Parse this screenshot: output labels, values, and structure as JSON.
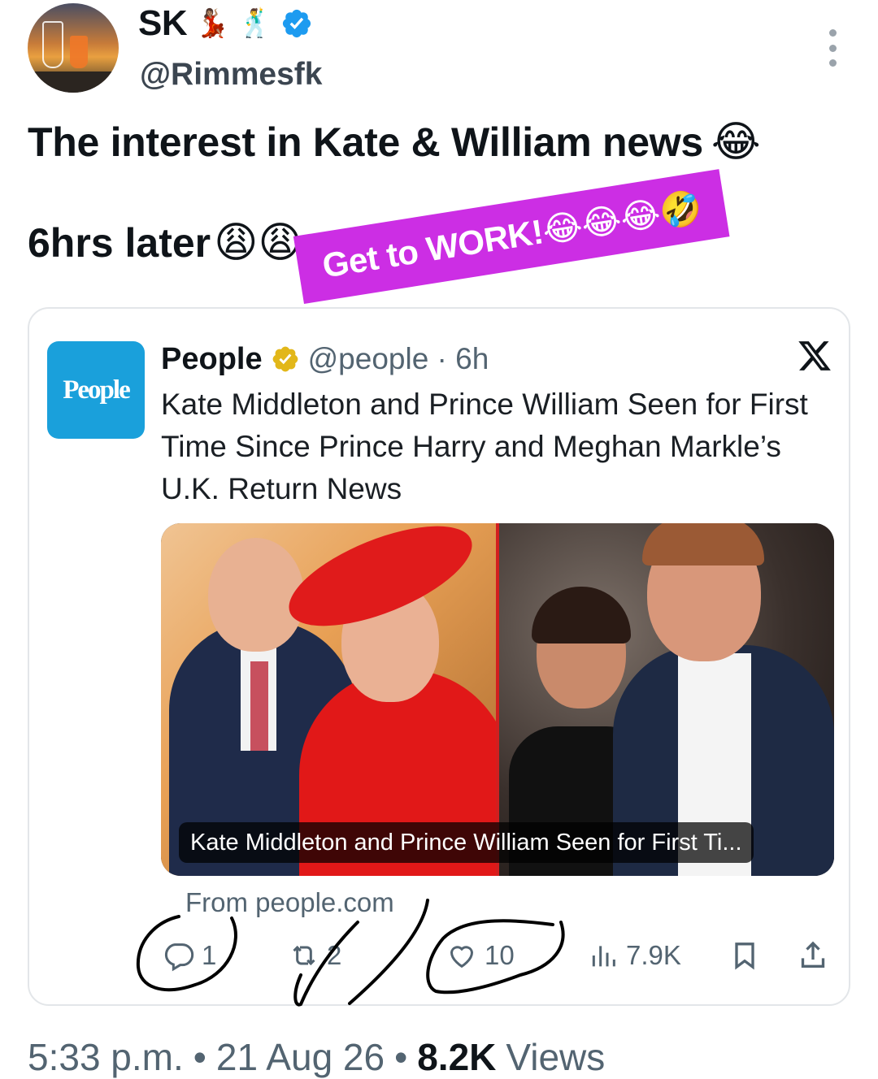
{
  "header": {
    "display_name": "SK",
    "name_emoji_1": "💃🏽",
    "name_emoji_2": "🕺",
    "handle": "@Rimmesfk"
  },
  "tweet": {
    "line1": "The interest in Kate & William news",
    "line1_emoji": "😂",
    "line2": "6hrs later",
    "line2_emoji": "😩😩"
  },
  "sticker": {
    "text": "Get to WORK!😂😂😂🤣"
  },
  "quoted": {
    "logo_text": "People",
    "source_name": "People",
    "source_handle": "@people · 6h",
    "headline": "Kate Middleton and Prince William Seen for First Time Since Prince Harry and Meghan Markle’s U.K. Return News",
    "image_caption": "Kate Middleton and Prince William Seen for First Ti...",
    "from_text": "From people.com"
  },
  "actions": {
    "reply_count": "1",
    "retweet_count": "2",
    "like_count": "10",
    "views_count": "7.9K"
  },
  "meta": {
    "time": "5:33 p.m.",
    "date": "21 Aug 26",
    "views_number": "8.2K",
    "views_label": "Views"
  },
  "colors": {
    "verified_blue": "#1d9bf0",
    "sticker_purple": "#cc2ee4",
    "people_blue": "#1aa0db",
    "gold_badge": "#e2b719"
  }
}
